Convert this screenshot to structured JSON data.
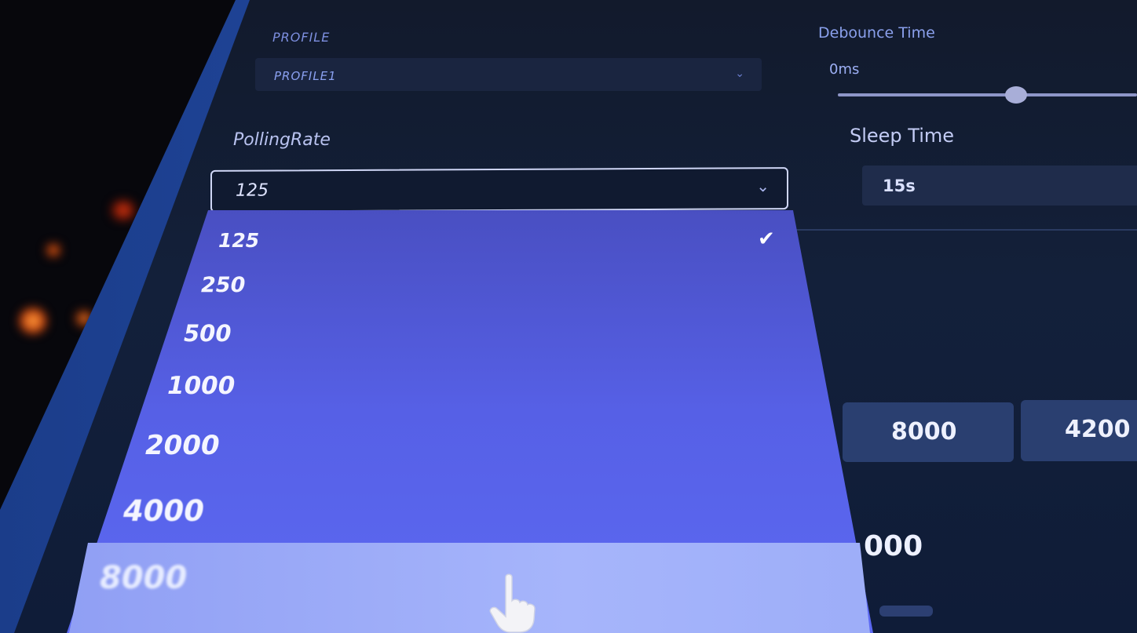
{
  "profile": {
    "label": "PROFILE",
    "value": "PROFILE1"
  },
  "polling_rate": {
    "label": "PollingRate",
    "value": "125",
    "options": [
      "125",
      "250",
      "500",
      "1000",
      "2000",
      "4000",
      "8000"
    ],
    "selected_index": 0,
    "highlighted_index": 6
  },
  "debounce": {
    "label": "Debounce Time",
    "value": "0ms"
  },
  "sleep": {
    "label": "Sleep Time",
    "value": "15s"
  },
  "presets": {
    "values": [
      "8000",
      "4200"
    ],
    "partial_value": "000"
  },
  "colors": {
    "dropdown_top": "#3a3f98",
    "dropdown_bottom": "#5c69f2",
    "highlight": "#a6b5fb",
    "panel": "#13203a"
  }
}
